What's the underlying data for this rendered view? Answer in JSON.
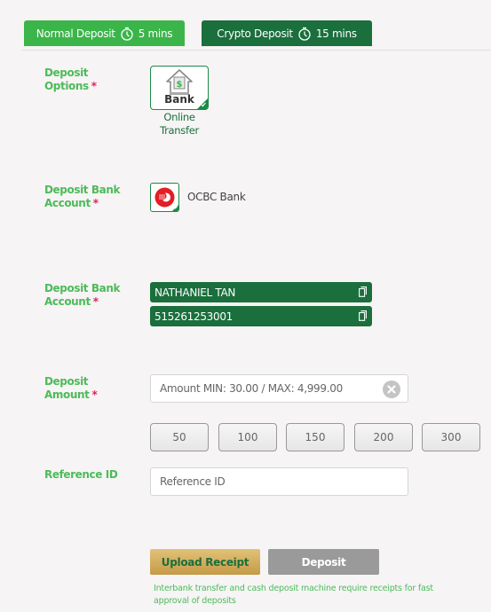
{
  "tabs": [
    {
      "label": "Normal Deposit",
      "time": "5 mins",
      "icon": "stopwatch-icon",
      "active": true
    },
    {
      "label": "Crypto Deposit",
      "time": "15 mins",
      "icon": "stopwatch-icon",
      "active": false
    }
  ],
  "deposit_options": {
    "label": "Deposit Options",
    "required_mark": "*",
    "tile_text": "Bank",
    "caption": "Online Transfer",
    "selected": true
  },
  "deposit_bank": {
    "label": "Deposit Bank Account",
    "required_mark": "*",
    "bank_name": "OCBC Bank",
    "selected": true
  },
  "account_details": {
    "label": "Deposit Bank Account",
    "required_mark": "*",
    "account_name": "NATHANIEL TAN",
    "account_number": "515261253001"
  },
  "deposit_amount": {
    "label": "Deposit Amount",
    "required_mark": "*",
    "placeholder": "Amount MIN: 30.00 / MAX: 4,999.00",
    "value": ""
  },
  "quick_amounts": [
    "50",
    "100",
    "150",
    "200",
    "300"
  ],
  "reference": {
    "label": "Reference ID",
    "placeholder": "Reference ID",
    "value": ""
  },
  "actions": {
    "upload_label": "Upload Receipt",
    "deposit_label": "Deposit"
  },
  "note": "Interbank transfer and cash deposit machine require receipts for fast approval of deposits",
  "colors": {
    "tab_active": "#3bb54a",
    "tab_inactive": "#1a6f3c",
    "label_green": "#4dbb5a",
    "required_red": "#e0245e",
    "account_bg": "#1a6f3c",
    "upload_gold": "#d4ad5f",
    "deposit_gray": "#9a9a9a"
  }
}
